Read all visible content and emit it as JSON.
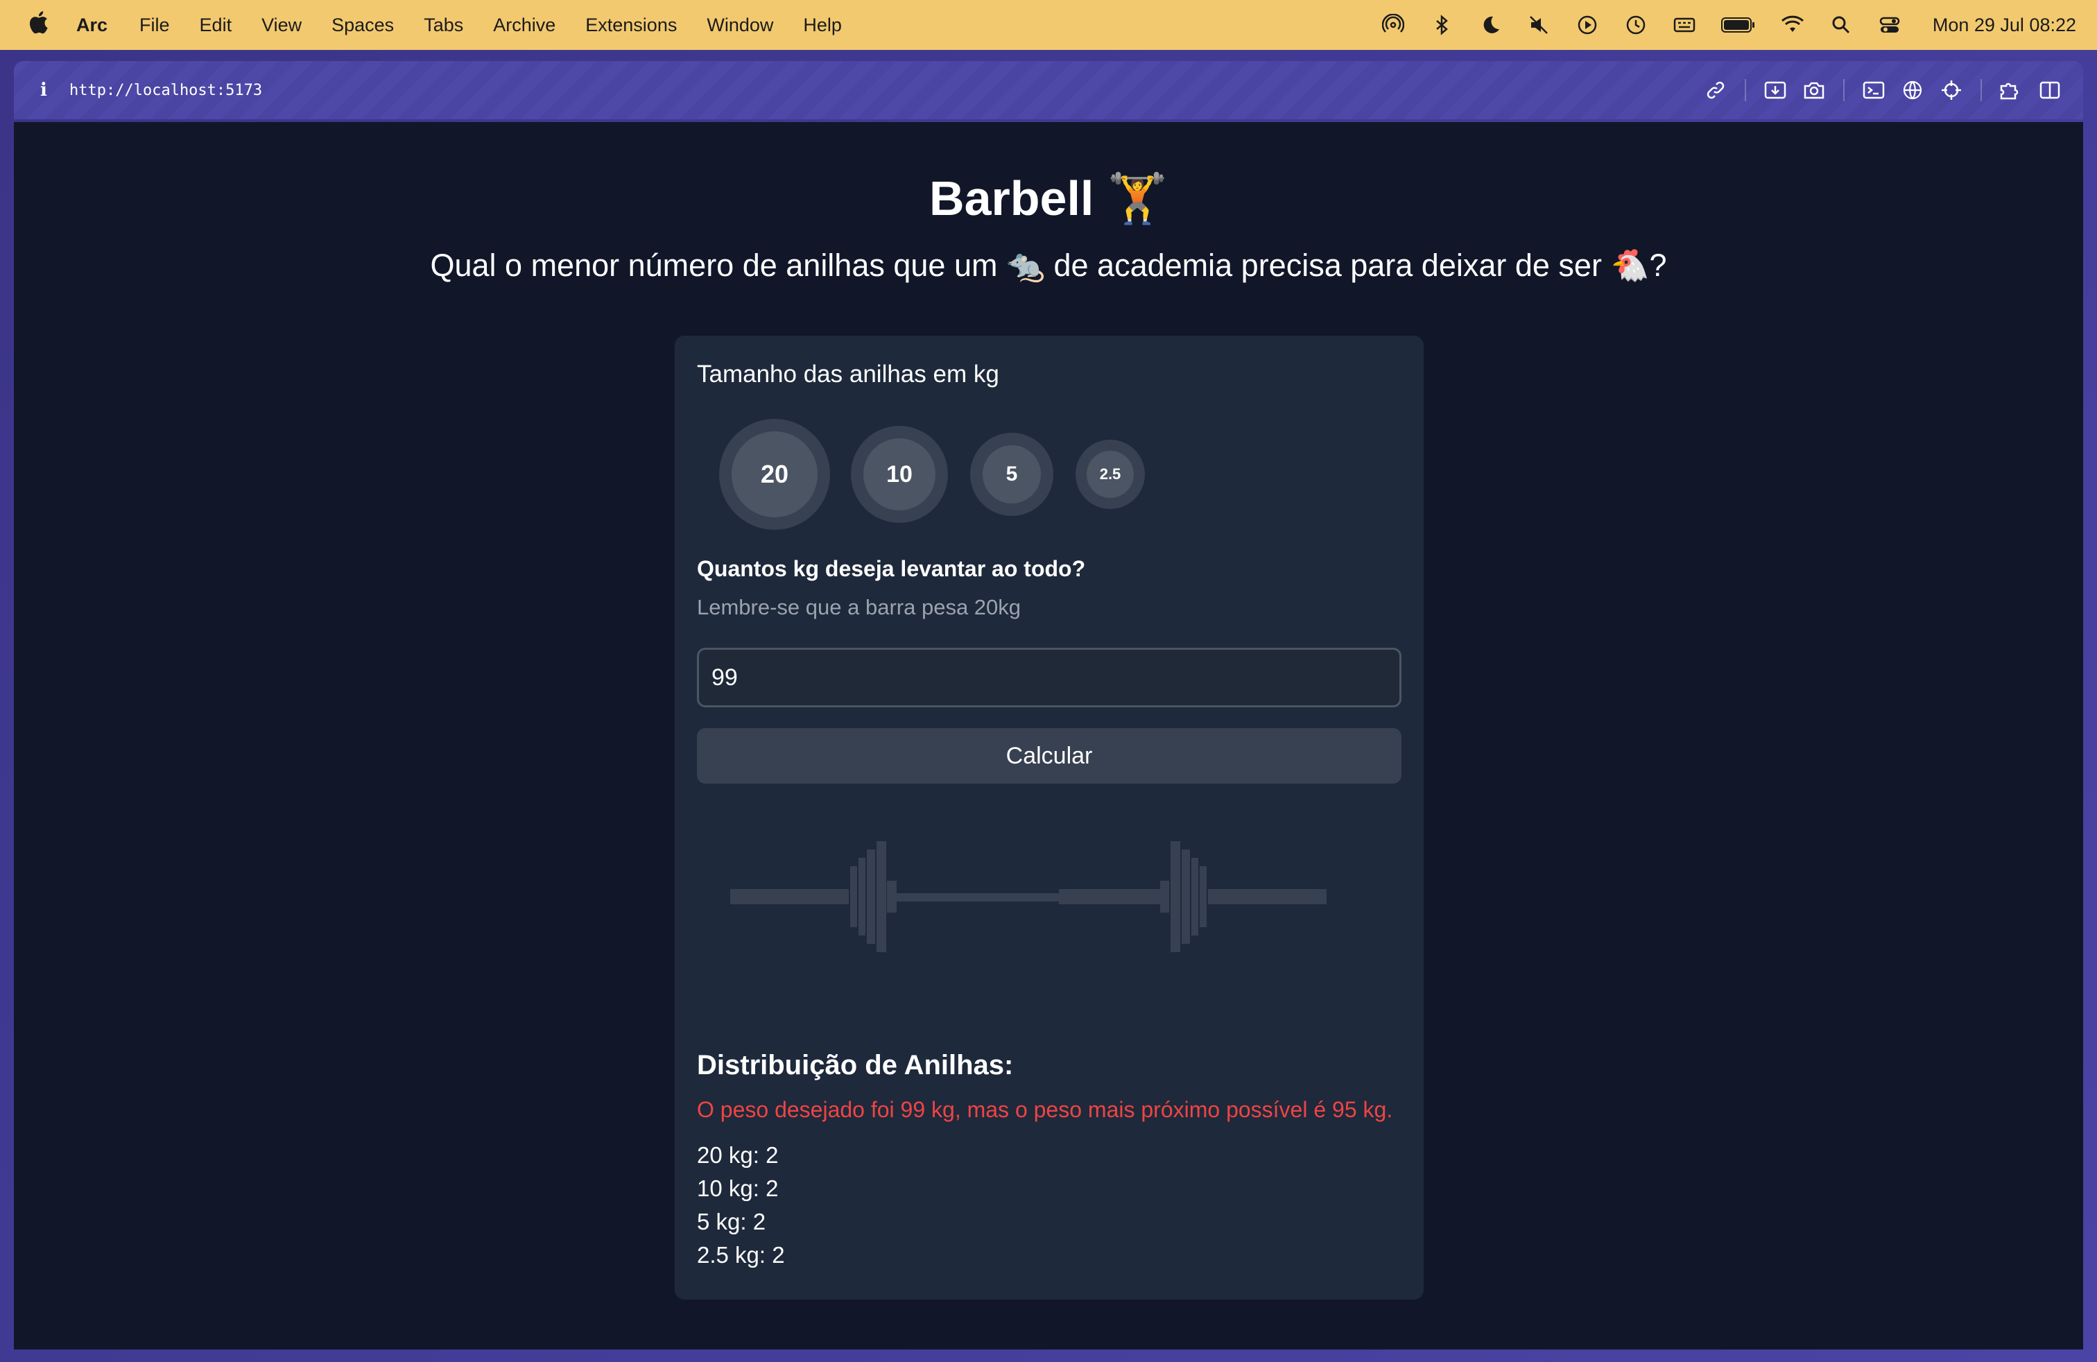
{
  "menubar": {
    "app_name": "Arc",
    "items": [
      "File",
      "Edit",
      "View",
      "Spaces",
      "Tabs",
      "Archive",
      "Extensions",
      "Window",
      "Help"
    ],
    "clock": "Mon 29 Jul  08:22",
    "status_icons": [
      "airdrop-icon",
      "bluetooth-icon",
      "moon-icon",
      "mute-icon",
      "play-icon",
      "clock-icon",
      "keyboard-icon",
      "battery-icon",
      "wifi-icon",
      "search-icon",
      "control-center-icon"
    ]
  },
  "browser": {
    "url": "http://localhost:5173",
    "toolbar_icons": [
      "link-icon",
      "capture-icon",
      "camera-icon",
      "terminal-icon",
      "globe-icon",
      "crosshair-icon",
      "extensions-icon",
      "sidebar-icon"
    ]
  },
  "page": {
    "title": "Barbell 🏋️",
    "subtitle": "Qual o menor número de anilhas que um 🐀 de academia precisa para deixar de ser 🐔?",
    "plates_label": "Tamanho das anilhas em kg",
    "plates": [
      "20",
      "10",
      "5",
      "2.5"
    ],
    "question": "Quantos kg deseja levantar ao todo?",
    "hint": "Lembre-se que a barra pesa 20kg",
    "weight_value": "99",
    "calculate_label": "Calcular",
    "distribution_title": "Distribuição de Anilhas:",
    "warning": "O peso desejado foi 99 kg, mas o peso mais próximo possível é 95 kg.",
    "distribution": [
      "20 kg: 2",
      "10 kg: 2",
      "5 kg: 2",
      "2.5 kg: 2"
    ]
  },
  "colors": {
    "menubar_bg": "#f2c96f",
    "browser_frame": "#403a95",
    "page_bg": "#111729",
    "card_bg": "#1e293b",
    "button_bg": "#374151",
    "warning": "#ef4444"
  }
}
